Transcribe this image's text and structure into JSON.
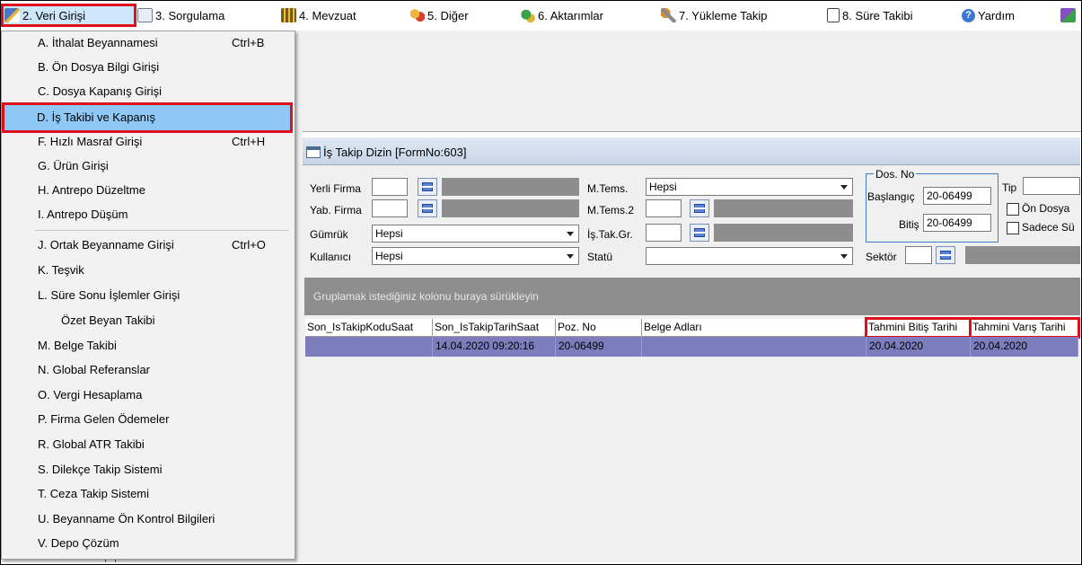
{
  "menubar": {
    "items": [
      {
        "label": "2.  Veri Girişi",
        "icon": "pencil-icon"
      },
      {
        "label": "3.  Sorgulama",
        "icon": "magnifier-icon"
      },
      {
        "label": "4.  Mevzuat",
        "icon": "books-icon"
      },
      {
        "label": "5.  Diğer",
        "icon": "people-icon"
      },
      {
        "label": "6.  Aktarımlar",
        "icon": "transfer-icon"
      },
      {
        "label": "7.  Yükleme Takip",
        "icon": "wrench-icon"
      },
      {
        "label": "8. Süre Takibi",
        "icon": "calendar-icon"
      },
      {
        "label": "Yardım",
        "icon": "help-icon"
      },
      {
        "label": "",
        "icon": "book-icon"
      }
    ]
  },
  "dropdown": {
    "items": [
      {
        "label": "A.  İthalat Beyannamesi",
        "shortcut": "Ctrl+B"
      },
      {
        "label": "B.  Ön Dosya Bilgi Girişi",
        "shortcut": ""
      },
      {
        "label": "C.  Dosya Kapanış Girişi",
        "shortcut": ""
      },
      {
        "label": "D.  İş Takibi ve Kapanış",
        "shortcut": ""
      },
      {
        "label": "F.  Hızlı Masraf Girişi",
        "shortcut": "Ctrl+H"
      },
      {
        "label": "G.  Ürün Girişi",
        "shortcut": ""
      },
      {
        "label": "H.  Antrepo Düzeltme",
        "shortcut": ""
      },
      {
        "label": "I.  Antrepo Düşüm",
        "shortcut": ""
      },
      {
        "label": "J.  Ortak Beyanname Girişi",
        "shortcut": "Ctrl+O"
      },
      {
        "label": "K.  Teşvik",
        "shortcut": ""
      },
      {
        "label": "L.  Süre Sonu İşlemler Girişi",
        "shortcut": ""
      },
      {
        "label": "Özet Beyan Takibi",
        "shortcut": ""
      },
      {
        "label": "M.  Belge Takibi",
        "shortcut": ""
      },
      {
        "label": "N. Global Referanslar",
        "shortcut": ""
      },
      {
        "label": "O. Vergi Hesaplama",
        "shortcut": ""
      },
      {
        "label": "P. Firma Gelen Ödemeler",
        "shortcut": ""
      },
      {
        "label": "R. Global ATR Takibi",
        "shortcut": ""
      },
      {
        "label": "S. Dilekçe Takip Sistemi",
        "shortcut": ""
      },
      {
        "label": "T. Ceza Takip Sistemi",
        "shortcut": ""
      },
      {
        "label": "U. Beyanname Ön Kontrol Bilgileri",
        "shortcut": ""
      },
      {
        "label": "V. Depo Çözüm",
        "shortcut": ""
      }
    ]
  },
  "window": {
    "title": "İş Takip Dizin [FormNo:603]",
    "filters": {
      "yerli_firma_label": "Yerli Firma",
      "yab_firma_label": "Yab. Firma",
      "gumruk_label": "Gümrük",
      "gumruk_value": "Hepsi",
      "kullanici_label": "Kullanıcı",
      "kullanici_value": "Hepsi",
      "mtems_label": "M.Tems.",
      "mtems_value": "Hepsi",
      "mtems2_label": "M.Tems.2",
      "istak_label": "İş.Tak.Gr.",
      "statu_label": "Statü",
      "dosno_title": "Dos. No",
      "baslangic_label": "Başlangıç",
      "baslangic_value": "20-06499",
      "bitis_label": "Bitiş",
      "bitis_value": "20-06499",
      "tip_label": "Tip",
      "on_dosya_label": "Ön Dosya",
      "sadece_label": "Sadece Sü",
      "sektor_label": "Sektör"
    },
    "group_hint": "Gruplamak istediğiniz kolonu buraya sürükleyin",
    "grid": {
      "columns": [
        "Son_IsTakipKoduSaat",
        "Son_IsTakipTarihSaat",
        "Poz. No",
        "Belge Adları",
        "Tahmini Bitiş Tarihi",
        "Tahmini Varış Tarihi"
      ],
      "rows": [
        [
          "",
          "14.04.2020 09:20:16",
          "20-06499",
          "",
          "20.04.2020",
          "20.04.2020"
        ]
      ]
    }
  }
}
